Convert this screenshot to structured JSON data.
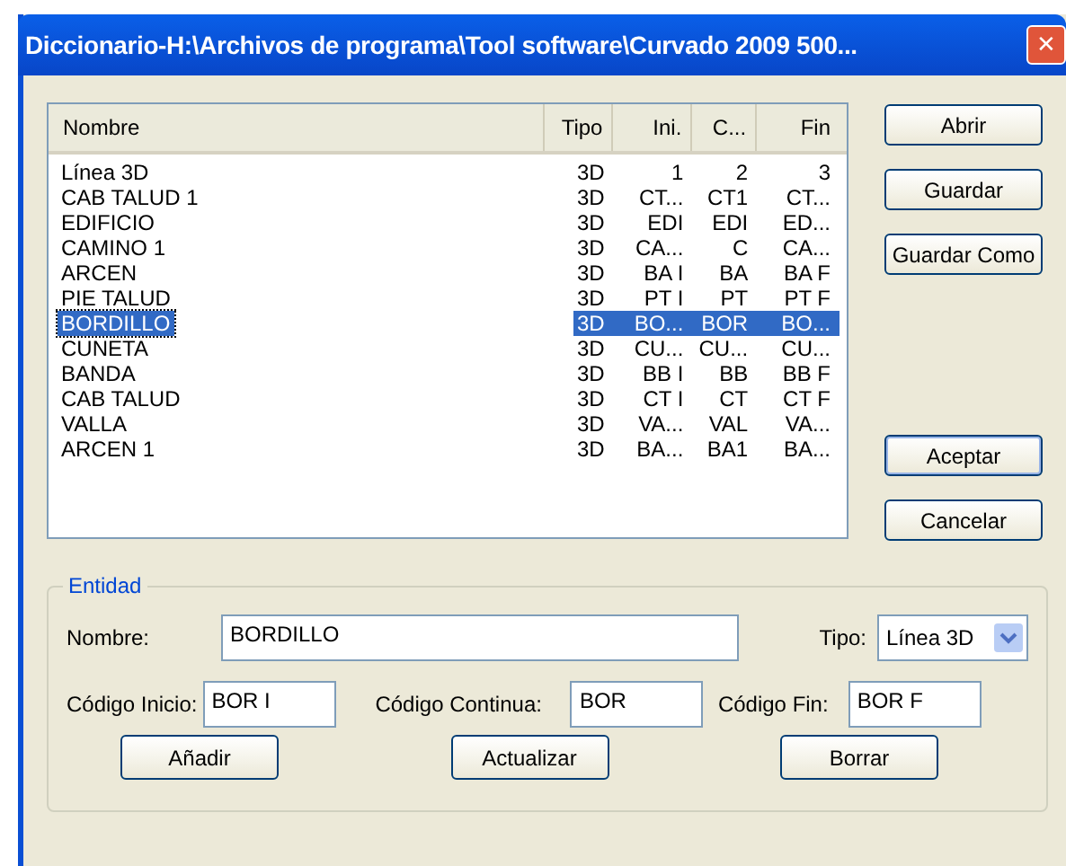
{
  "window": {
    "title": "Diccionario-H:\\Archivos de programa\\Tool software\\Curvado 2009 500...",
    "close": "✕"
  },
  "table": {
    "columns": [
      "Nombre",
      "Tipo",
      "Ini.",
      "C...",
      "Fin"
    ],
    "rows": [
      {
        "cells": [
          "Línea 3D",
          "3D",
          "1",
          "2",
          "3"
        ],
        "selected": false
      },
      {
        "cells": [
          "CAB TALUD 1",
          "3D",
          "CT...",
          "CT1",
          "CT..."
        ],
        "selected": false
      },
      {
        "cells": [
          "EDIFICIO",
          "3D",
          "EDI",
          "EDI",
          "ED..."
        ],
        "selected": false
      },
      {
        "cells": [
          "CAMINO 1",
          "3D",
          "CA...",
          "C",
          "CA..."
        ],
        "selected": false
      },
      {
        "cells": [
          "ARCEN",
          "3D",
          "BA I",
          "BA",
          "BA F"
        ],
        "selected": false
      },
      {
        "cells": [
          "PIE TALUD",
          "3D",
          "PT I",
          "PT",
          "PT F"
        ],
        "selected": false
      },
      {
        "cells": [
          "BORDILLO",
          "3D",
          "BO...",
          "BOR",
          "BO..."
        ],
        "selected": true
      },
      {
        "cells": [
          "CUNETA",
          "3D",
          "CU...",
          "CU...",
          "CU..."
        ],
        "selected": false
      },
      {
        "cells": [
          "BANDA",
          "3D",
          "BB I",
          "BB",
          "BB F"
        ],
        "selected": false
      },
      {
        "cells": [
          "CAB TALUD",
          "3D",
          "CT I",
          "CT",
          "CT F"
        ],
        "selected": false
      },
      {
        "cells": [
          "VALLA",
          "3D",
          "VA...",
          "VAL",
          "VA..."
        ],
        "selected": false
      },
      {
        "cells": [
          "ARCEN 1",
          "3D",
          "BA...",
          "BA1",
          "BA..."
        ],
        "selected": false
      }
    ]
  },
  "side_buttons_top": [
    "Abrir",
    "Guardar",
    "Guardar Como"
  ],
  "side_buttons_bottom": [
    "Aceptar",
    "Cancelar"
  ],
  "entidad": {
    "title": "Entidad",
    "nombre_label": "Nombre:",
    "nombre": "BORDILLO",
    "tipo_label": "Tipo:",
    "tipo": "Línea 3D",
    "inicio_label": "Código Inicio:",
    "inicio": "BOR I",
    "continua_label": "Código Continua:",
    "continua": "BOR",
    "fin_label": "Código Fin:",
    "fin": "BOR F",
    "buttons": [
      "Añadir",
      "Actualizar",
      "Borrar"
    ]
  }
}
